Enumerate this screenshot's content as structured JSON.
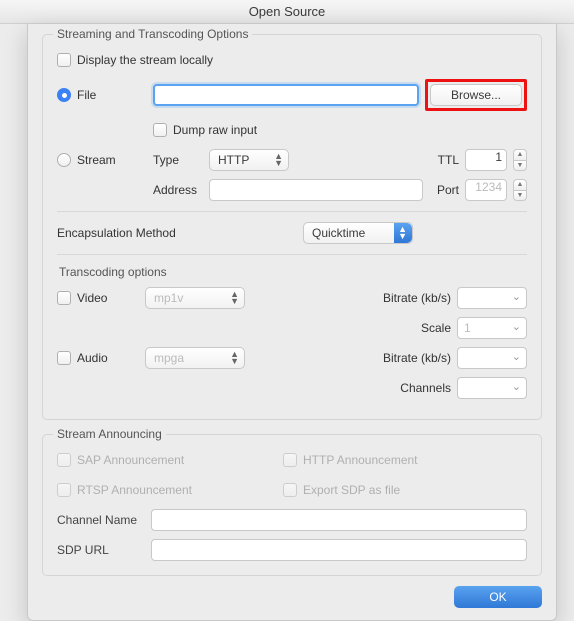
{
  "title": "Open Source",
  "streaming": {
    "heading": "Streaming and Transcoding Options",
    "display_locally": "Display the stream locally",
    "file_label": "File",
    "file_value": "",
    "browse": "Browse...",
    "dump_raw": "Dump raw input",
    "stream_label": "Stream",
    "type_label": "Type",
    "type_value": "HTTP",
    "ttl_label": "TTL",
    "ttl_value": "1",
    "address_label": "Address",
    "address_value": "",
    "port_label": "Port",
    "port_placeholder": "1234",
    "encaps_label": "Encapsulation Method",
    "encaps_value": "Quicktime"
  },
  "transcoding": {
    "heading": "Transcoding options",
    "video_label": "Video",
    "video_codec": "mp1v",
    "bitrate_label": "Bitrate (kb/s)",
    "scale_label": "Scale",
    "scale_value": "1",
    "audio_label": "Audio",
    "audio_codec": "mpga",
    "channels_label": "Channels"
  },
  "announcing": {
    "heading": "Stream Announcing",
    "sap": "SAP Announcement",
    "http": "HTTP Announcement",
    "rtsp": "RTSP Announcement",
    "export_sdp": "Export SDP as file",
    "channel_name": "Channel Name",
    "sdp_url": "SDP URL"
  },
  "ok": "OK"
}
